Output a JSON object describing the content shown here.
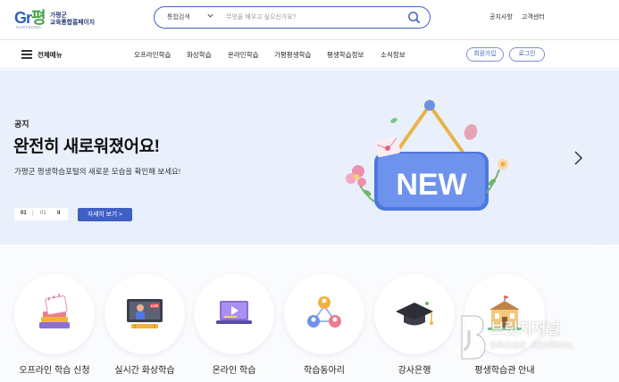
{
  "header": {
    "logo_text_line1": "가평군",
    "logo_text_line2": "교육통합홈페이지",
    "logo_sub": "GAPYEONG",
    "search": {
      "category": "통합검색",
      "placeholder": "무엇을 배우고 싶으신가요?"
    },
    "links": [
      "공지사항",
      "고객센터"
    ]
  },
  "nav": {
    "menu_label": "전체메뉴",
    "items": [
      "오프라인학습",
      "화상학습",
      "온라인학습",
      "가평평생학습",
      "평생학습정보",
      "소식정보"
    ],
    "signup": "회원가입",
    "login": "로그인"
  },
  "hero": {
    "category": "공지",
    "title": "완전히 새로워졌어요!",
    "description": "가평군 평생학습포털의 새로운 모습을 확인해 보세요!",
    "pager": {
      "current": "01",
      "separator": "|",
      "total": "01",
      "pause": "II"
    },
    "detail_button": "자세히 보기  >",
    "sign_text": "NEW"
  },
  "quick_links": [
    {
      "label": "오프라인 학습 신청",
      "icon": "books-calendar-icon"
    },
    {
      "label": "실시간 화상학습",
      "icon": "live-lecture-icon"
    },
    {
      "label": "온라인 학습",
      "icon": "laptop-play-icon"
    },
    {
      "label": "학습동아리",
      "icon": "community-icon"
    },
    {
      "label": "강사은행",
      "icon": "graduation-cap-icon"
    },
    {
      "label": "평생학습관 안내",
      "icon": "building-icon"
    }
  ],
  "watermark": {
    "title": "브릿지저널",
    "subtitle": "BRIDGE JOURNAL"
  },
  "colors": {
    "primary": "#3f5fc4",
    "hero_bg": "#e9f0fb",
    "logo_green": "#46a34a"
  }
}
